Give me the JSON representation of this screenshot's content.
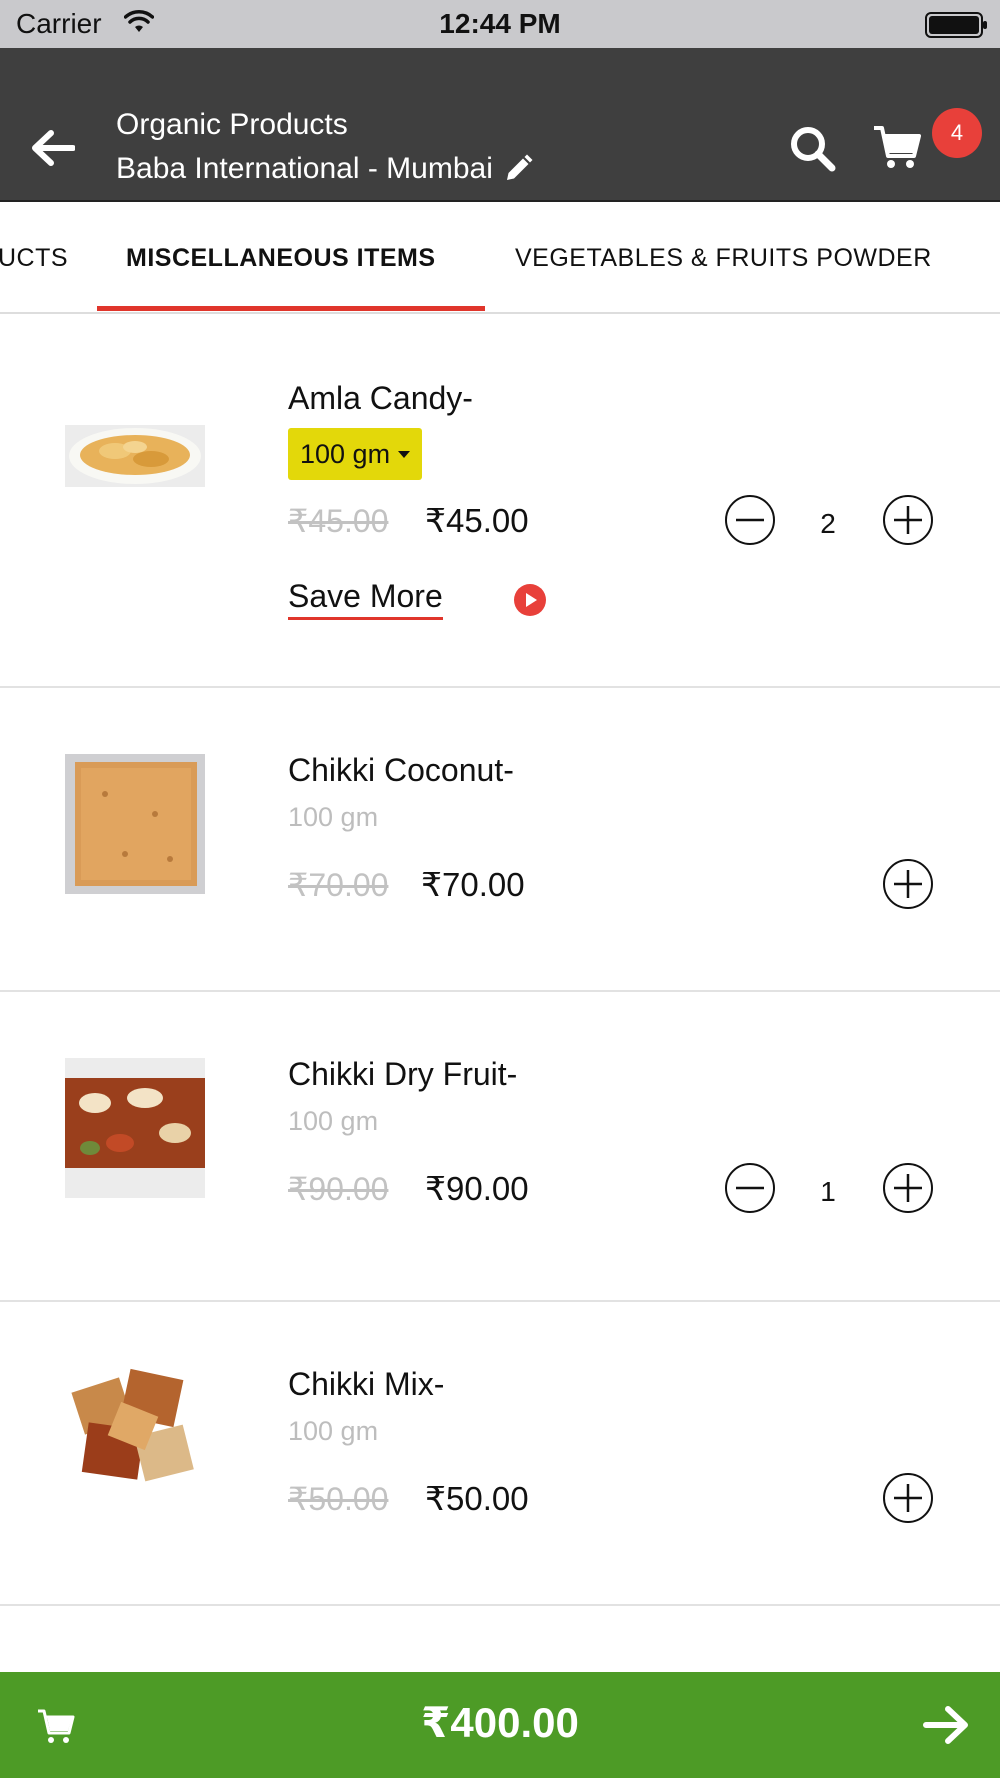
{
  "status_bar": {
    "carrier": "Carrier",
    "time": "12:44 PM"
  },
  "header": {
    "title": "Organic Products",
    "subtitle": "Baba International - Mumbai",
    "cart_count": "4",
    "icons": [
      "back-arrow-icon",
      "edit-pencil-icon",
      "search-icon",
      "cart-icon"
    ]
  },
  "tabs": [
    {
      "label": "UCTS",
      "active": false
    },
    {
      "label": "MISCELLANEOUS ITEMS",
      "active": true
    },
    {
      "label": "VEGETABLES & FRUITS POWDER",
      "active": false
    }
  ],
  "products": [
    {
      "name": "Amla Candy-",
      "size": "100 gm",
      "size_is_dropdown": true,
      "old_price": "₹45.00",
      "price": "₹45.00",
      "quantity": "2",
      "save_more": "Save More"
    },
    {
      "name": "Chikki Coconut-",
      "size": "100 gm",
      "old_price": "₹70.00",
      "price": "₹70.00"
    },
    {
      "name": "Chikki Dry Fruit-",
      "size": "100 gm",
      "old_price": "₹90.00",
      "price": "₹90.00",
      "quantity": "1"
    },
    {
      "name": "Chikki Mix-",
      "size": "100 gm",
      "old_price": "₹50.00",
      "price": "₹50.00"
    }
  ],
  "footer": {
    "total": "₹400.00"
  },
  "colors": {
    "nav_bg": "#3f3f3f",
    "accent_red": "#e0352b",
    "size_highlight": "#e3d80a",
    "footer_green": "#4d9b26"
  }
}
